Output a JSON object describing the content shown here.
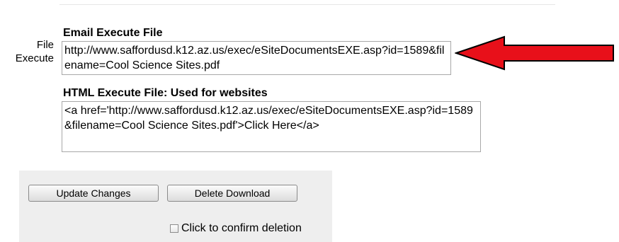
{
  "form": {
    "side_label": "File\nExecute",
    "email_heading": "Email Execute File",
    "email_value": "http://www.saffordusd.k12.az.us/exec/eSiteDocumentsEXE.asp?id=1589&filename=Cool Science Sites.pdf",
    "html_heading": "HTML Execute File: Used for websites",
    "html_value": "<a href='http://www.saffordusd.k12.az.us/exec/eSiteDocumentsEXE.asp?id=1589&filename=Cool Science Sites.pdf'>Click Here</a>"
  },
  "actions": {
    "update_label": "Update Changes",
    "delete_label": "Delete Download",
    "confirm_label": "Click to confirm deletion",
    "confirm_checked": false
  },
  "colors": {
    "arrow_fill": "#e8101a",
    "arrow_stroke": "#000000",
    "panel_bg": "#eeeeee"
  }
}
